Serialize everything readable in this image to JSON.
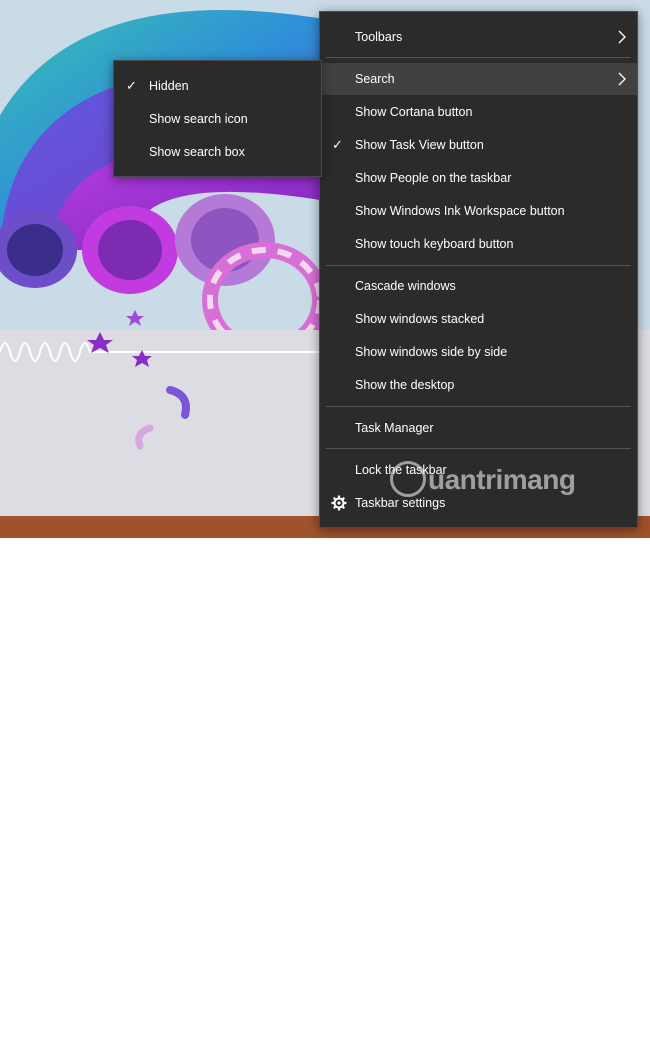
{
  "context_menu": {
    "toolbars": "Toolbars",
    "search": "Search",
    "show_cortana": "Show Cortana button",
    "show_task_view": "Show Task View button",
    "show_people": "Show People on the taskbar",
    "show_ink": "Show Windows Ink Workspace button",
    "show_touch_keyboard": "Show touch keyboard button",
    "cascade": "Cascade windows",
    "stacked": "Show windows stacked",
    "side_by_side": "Show windows side by side",
    "show_desktop": "Show the desktop",
    "task_manager": "Task Manager",
    "lock_taskbar": "Lock the taskbar",
    "taskbar_settings": "Taskbar settings",
    "checked_item": "Show Task View button"
  },
  "search_submenu": {
    "hidden": "Hidden",
    "show_icon": "Show search icon",
    "show_box": "Show search box",
    "selected": "Hidden"
  },
  "watermark": {
    "text": "uantrimang"
  },
  "colors": {
    "menu_bg": "#2b2b2b",
    "menu_hover": "#414141",
    "taskbar": "#a0522d",
    "text": "#ffffff"
  },
  "icons": [
    "check-icon",
    "chevron-right-icon",
    "gear-icon",
    "network-icon",
    "tray-icon"
  ]
}
